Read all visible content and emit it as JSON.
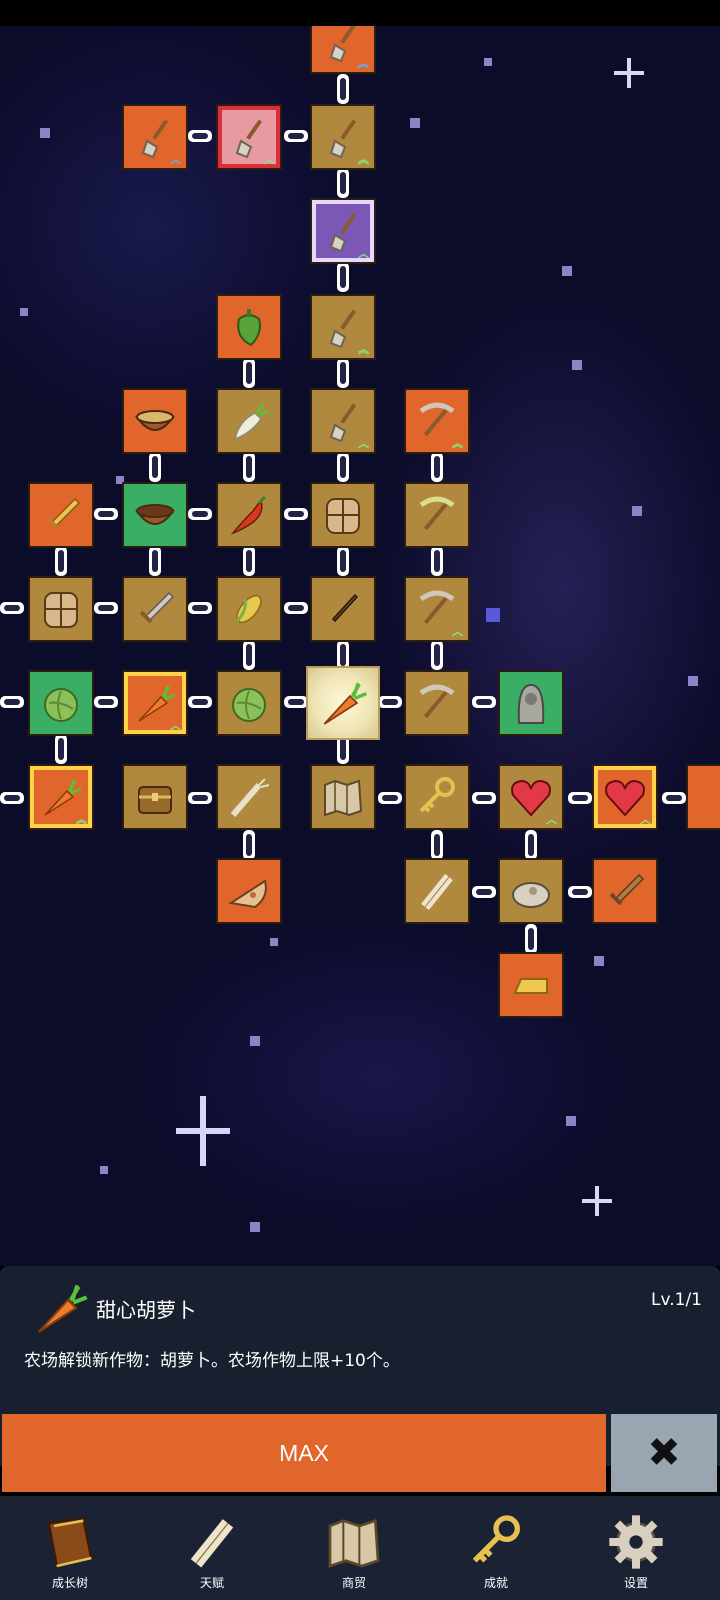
{
  "tree": {
    "selected": "甜心胡萝卜",
    "colors": {
      "orange": "#e0662b",
      "tan": "#b0883e",
      "green": "#3aae64",
      "purple": "#7a58b3",
      "background": "#0b0b2a"
    }
  },
  "detail": {
    "name": "甜心胡萝卜",
    "level": "Lv.1/1",
    "description": "农场解锁新作物：胡萝卜。农场作物上限+10个。",
    "icon": "carrot-icon"
  },
  "actions": {
    "max_label": "MAX",
    "close_icon": "close-icon"
  },
  "nav": {
    "items": [
      {
        "label": "成长树",
        "icon": "book-icon"
      },
      {
        "label": "天赋",
        "icon": "scroll-icon"
      },
      {
        "label": "商贸",
        "icon": "map-icon"
      },
      {
        "label": "成就",
        "icon": "key-icon"
      },
      {
        "label": "设置",
        "icon": "gear-icon"
      }
    ]
  }
}
